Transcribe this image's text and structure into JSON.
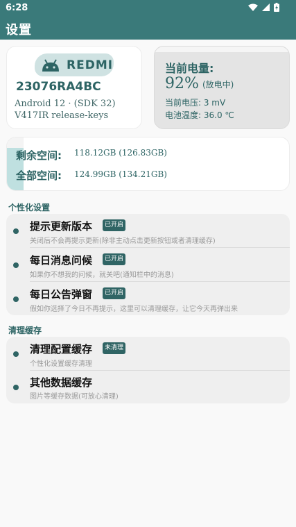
{
  "status_bar": {
    "time": "6:28"
  },
  "app_bar": {
    "title": "设置"
  },
  "device": {
    "brand": "REDMI",
    "model": "23076RA4BC",
    "android": "Android 12 · (SDK 32)",
    "build": "V417IR release-keys"
  },
  "battery": {
    "title": "当前电量:",
    "percent": "92%",
    "state": "(放电中)",
    "voltage": "当前电压:  3 mV",
    "temperature": "电池温度:  36.0 ℃"
  },
  "storage": {
    "free_label": "剩余空间:",
    "free_value": "118.12GB (126.83GB)",
    "total_label": "全部空间:",
    "total_value": "124.99GB (134.21GB)",
    "used_fraction": 0.8
  },
  "personalization": {
    "section_title": "个性化设置",
    "items": [
      {
        "title": "提示更新版本",
        "badge": "已开启",
        "subtitle": "关闭后不会再提示更新(除非主动点击更新按钮或者清理缓存)"
      },
      {
        "title": "每日消息问候",
        "badge": "已开启",
        "subtitle": "如果你不想我的问候，就关吧(通知栏中的消息)"
      },
      {
        "title": "每日公告弹窗",
        "badge": "已开启",
        "subtitle": "假如你选择了今日不再提示，这里可以清理缓存，让它今天再弹出来"
      }
    ]
  },
  "cache": {
    "section_title": "清理缓存",
    "items": [
      {
        "title": "清理配置缓存",
        "badge": "未清理",
        "subtitle": "个性化设置缓存清理"
      },
      {
        "title": "其他数据缓存",
        "subtitle": "图片等缓存数据(可放心清理)"
      }
    ]
  },
  "colors": {
    "primary": "#3a7a7a",
    "accent_text": "#2d6464",
    "light_teal": "#bfe0e0"
  }
}
